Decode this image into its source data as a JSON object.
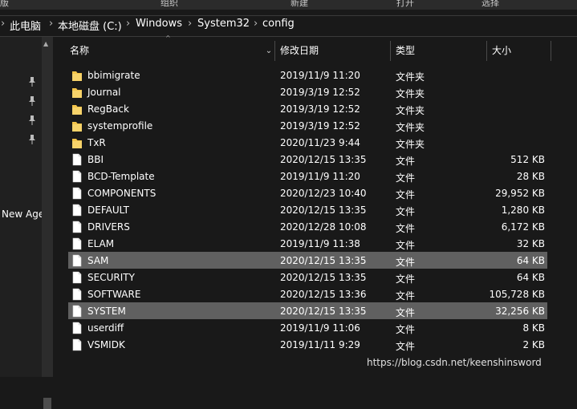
{
  "ribbon": {
    "items": [
      "版",
      "组织",
      "新建",
      "打开",
      "选择"
    ]
  },
  "breadcrumb": {
    "items": [
      "此电脑",
      "本地磁盘 (C:)",
      "Windows",
      "System32",
      "config"
    ]
  },
  "nav": {
    "partial_label": "New Age"
  },
  "columns": {
    "name": "名称",
    "date": "修改日期",
    "type": "类型",
    "size": "大小"
  },
  "files": [
    {
      "name": "bbimigrate",
      "date": "2019/11/9 11:20",
      "type": "文件夹",
      "size": "",
      "icon": "folder-icon",
      "selected": false
    },
    {
      "name": "Journal",
      "date": "2019/3/19 12:52",
      "type": "文件夹",
      "size": "",
      "icon": "folder-icon",
      "selected": false
    },
    {
      "name": "RegBack",
      "date": "2019/3/19 12:52",
      "type": "文件夹",
      "size": "",
      "icon": "folder-icon",
      "selected": false
    },
    {
      "name": "systemprofile",
      "date": "2019/3/19 12:52",
      "type": "文件夹",
      "size": "",
      "icon": "folder-icon",
      "selected": false
    },
    {
      "name": "TxR",
      "date": "2020/11/23 9:44",
      "type": "文件夹",
      "size": "",
      "icon": "folder-icon",
      "selected": false
    },
    {
      "name": "BBI",
      "date": "2020/12/15 13:35",
      "type": "文件",
      "size": "512 KB",
      "icon": "file-icon",
      "selected": false
    },
    {
      "name": "BCD-Template",
      "date": "2019/11/9 11:20",
      "type": "文件",
      "size": "28 KB",
      "icon": "file-icon",
      "selected": false
    },
    {
      "name": "COMPONENTS",
      "date": "2020/12/23 10:40",
      "type": "文件",
      "size": "29,952 KB",
      "icon": "file-icon",
      "selected": false
    },
    {
      "name": "DEFAULT",
      "date": "2020/12/15 13:35",
      "type": "文件",
      "size": "1,280 KB",
      "icon": "file-icon",
      "selected": false
    },
    {
      "name": "DRIVERS",
      "date": "2020/12/28 10:08",
      "type": "文件",
      "size": "6,172 KB",
      "icon": "file-icon",
      "selected": false
    },
    {
      "name": "ELAM",
      "date": "2019/11/9 11:38",
      "type": "文件",
      "size": "32 KB",
      "icon": "file-icon",
      "selected": false
    },
    {
      "name": "SAM",
      "date": "2020/12/15 13:35",
      "type": "文件",
      "size": "64 KB",
      "icon": "file-icon",
      "selected": true
    },
    {
      "name": "SECURITY",
      "date": "2020/12/15 13:35",
      "type": "文件",
      "size": "64 KB",
      "icon": "file-icon",
      "selected": false
    },
    {
      "name": "SOFTWARE",
      "date": "2020/12/15 13:36",
      "type": "文件",
      "size": "105,728 KB",
      "icon": "file-icon",
      "selected": false
    },
    {
      "name": "SYSTEM",
      "date": "2020/12/15 13:35",
      "type": "文件",
      "size": "32,256 KB",
      "icon": "file-icon",
      "selected": true
    },
    {
      "name": "userdiff",
      "date": "2019/11/9 11:06",
      "type": "文件",
      "size": "8 KB",
      "icon": "file-icon",
      "selected": false
    },
    {
      "name": "VSMIDK",
      "date": "2019/11/11 9:29",
      "type": "文件",
      "size": "2 KB",
      "icon": "file-icon",
      "selected": false
    }
  ],
  "watermark": "https://blog.csdn.net/keenshinsword",
  "colors": {
    "folder": "#f3c44a",
    "selection": "#606060",
    "background": "#191919"
  }
}
